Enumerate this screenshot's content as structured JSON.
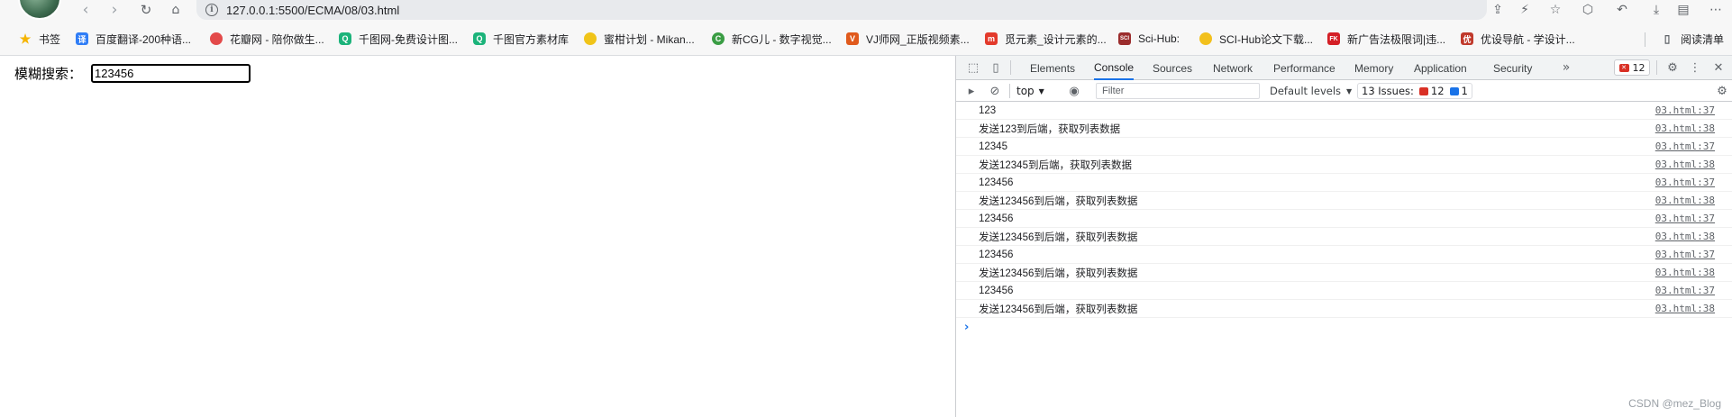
{
  "toolbar": {
    "url": "127.0.0.1:5500/ECMA/08/03.html",
    "icons": [
      "back-icon",
      "forward-icon",
      "reload-icon",
      "home-icon",
      "info-icon",
      "share-icon",
      "bolt-icon",
      "star-icon",
      "extensions-icon",
      "undo-icon",
      "download-icon",
      "sidebar-icon",
      "more-icon"
    ]
  },
  "bookmarks": [
    {
      "label": "书签",
      "icon": "star-icon",
      "color": "#f5b400"
    },
    {
      "label": "百度翻译-200种语...",
      "icon": "baidu-translate-icon",
      "color": "#2f7df6"
    },
    {
      "label": "花瓣网 - 陪你做生...",
      "icon": "huaban-icon",
      "color": "#e34a4a"
    },
    {
      "label": "千图网-免费设计图...",
      "icon": "qiantu-icon",
      "color": "#1bb37a"
    },
    {
      "label": "千图官方素材库",
      "icon": "qiantu-icon",
      "color": "#1bb37a"
    },
    {
      "label": "蜜柑计划 - Mikan...",
      "icon": "mikan-icon",
      "color": "#f0c419"
    },
    {
      "label": "新CG儿 - 数字视觉...",
      "icon": "cg-icon",
      "color": "#3a9d44"
    },
    {
      "label": "VJ师网_正版视频素...",
      "icon": "vj-icon",
      "color": "#e05a1c"
    },
    {
      "label": "觅元素_设计元素的...",
      "icon": "miyuansu-icon",
      "color": "#e33a2c"
    },
    {
      "label": "Sci-Hub:",
      "icon": "scihub-icon",
      "color": "#9b2d2d"
    },
    {
      "label": "SCI-Hub论文下载...",
      "icon": "scihub-download-icon",
      "color": "#f2c01c"
    },
    {
      "label": "新广告法极限词|违...",
      "icon": "fk-icon",
      "color": "#d41f26"
    },
    {
      "label": "优设导航 - 学设计...",
      "icon": "uisdc-icon",
      "color": "#c0392b"
    },
    {
      "label": "阅读清单",
      "icon": "reading-list-icon",
      "color": "#5f6368"
    }
  ],
  "page": {
    "search_label": "模糊搜索：",
    "search_value": "123456"
  },
  "devtools": {
    "tabs": [
      "Elements",
      "Console",
      "Sources",
      "Network",
      "Performance",
      "Memory",
      "Application",
      "Security"
    ],
    "active_tab": "Console",
    "error_badge_count": "12",
    "context": "top",
    "filter_placeholder": "Filter",
    "levels_label": "Default levels",
    "issues_label": "13 Issues:",
    "issues_errors": "12",
    "issues_info": "1",
    "console_rows": [
      {
        "msg": "123",
        "src": "03.html:37"
      },
      {
        "msg": "发送123到后端，获取列表数据",
        "src": "03.html:38"
      },
      {
        "msg": "12345",
        "src": "03.html:37"
      },
      {
        "msg": "发送12345到后端，获取列表数据",
        "src": "03.html:38"
      },
      {
        "msg": "123456",
        "src": "03.html:37"
      },
      {
        "msg": "发送123456到后端，获取列表数据",
        "src": "03.html:38"
      },
      {
        "msg": "123456",
        "src": "03.html:37"
      },
      {
        "msg": "发送123456到后端，获取列表数据",
        "src": "03.html:38"
      },
      {
        "msg": "123456",
        "src": "03.html:37"
      },
      {
        "msg": "发送123456到后端，获取列表数据",
        "src": "03.html:38"
      },
      {
        "msg": "123456",
        "src": "03.html:37"
      },
      {
        "msg": "发送123456到后端，获取列表数据",
        "src": "03.html:38"
      }
    ],
    "prompt": "›"
  },
  "watermark": "CSDN @mez_Blog"
}
